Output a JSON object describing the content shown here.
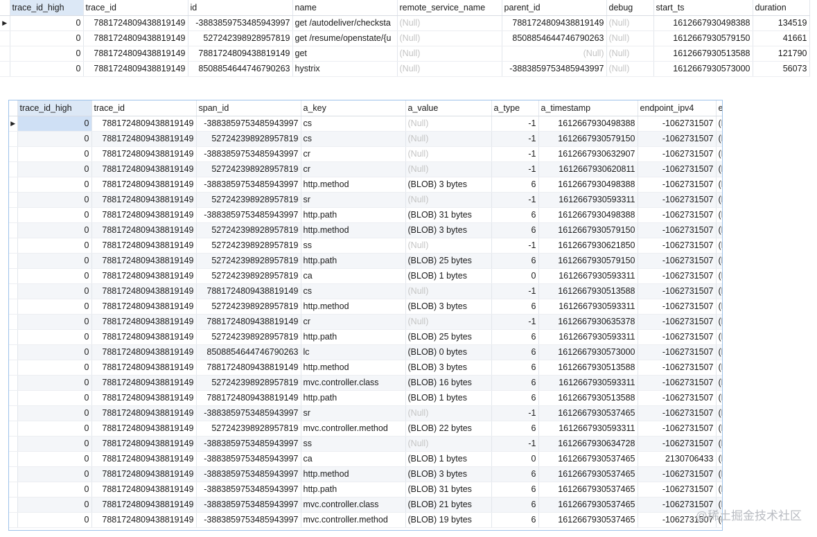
{
  "grid1": {
    "columns": [
      "trace_id_high",
      "trace_id",
      "id",
      "name",
      "remote_service_name",
      "parent_id",
      "debug",
      "start_ts",
      "duration"
    ],
    "rows": [
      [
        "0",
        "7881724809438819149",
        "-3883859753485943997",
        "get /autodeliver/checksta",
        "(Null)",
        "7881724809438819149",
        "(Null)",
        "1612667930498388",
        "134519"
      ],
      [
        "0",
        "7881724809438819149",
        "527242398928957819",
        "get /resume/openstate/{u",
        "(Null)",
        "8508854644746790263",
        "(Null)",
        "1612667930579150",
        "41661"
      ],
      [
        "0",
        "7881724809438819149",
        "7881724809438819149",
        "get",
        "(Null)",
        "(Null)",
        "(Null)",
        "1612667930513588",
        "121790"
      ],
      [
        "0",
        "7881724809438819149",
        "8508854644746790263",
        "hystrix",
        "(Null)",
        "-3883859753485943997",
        "(Null)",
        "1612667930573000",
        "56073"
      ]
    ]
  },
  "grid2": {
    "columns": [
      "trace_id_high",
      "trace_id",
      "span_id",
      "a_key",
      "a_value",
      "a_type",
      "a_timestamp",
      "endpoint_ipv4",
      "e"
    ],
    "rows": [
      [
        "0",
        "7881724809438819149",
        "-3883859753485943997",
        "cs",
        "(Null)",
        "-1",
        "1612667930498388",
        "-1062731507",
        "(N"
      ],
      [
        "0",
        "7881724809438819149",
        "527242398928957819",
        "cs",
        "(Null)",
        "-1",
        "1612667930579150",
        "-1062731507",
        "(N"
      ],
      [
        "0",
        "7881724809438819149",
        "-3883859753485943997",
        "cr",
        "(Null)",
        "-1",
        "1612667930632907",
        "-1062731507",
        "(N"
      ],
      [
        "0",
        "7881724809438819149",
        "527242398928957819",
        "cr",
        "(Null)",
        "-1",
        "1612667930620811",
        "-1062731507",
        "(N"
      ],
      [
        "0",
        "7881724809438819149",
        "-3883859753485943997",
        "http.method",
        "(BLOB) 3 bytes",
        "6",
        "1612667930498388",
        "-1062731507",
        "(N"
      ],
      [
        "0",
        "7881724809438819149",
        "527242398928957819",
        "sr",
        "(Null)",
        "-1",
        "1612667930593311",
        "-1062731507",
        "(N"
      ],
      [
        "0",
        "7881724809438819149",
        "-3883859753485943997",
        "http.path",
        "(BLOB) 31 bytes",
        "6",
        "1612667930498388",
        "-1062731507",
        "(N"
      ],
      [
        "0",
        "7881724809438819149",
        "527242398928957819",
        "http.method",
        "(BLOB) 3 bytes",
        "6",
        "1612667930579150",
        "-1062731507",
        "(N"
      ],
      [
        "0",
        "7881724809438819149",
        "527242398928957819",
        "ss",
        "(Null)",
        "-1",
        "1612667930621850",
        "-1062731507",
        "(N"
      ],
      [
        "0",
        "7881724809438819149",
        "527242398928957819",
        "http.path",
        "(BLOB) 25 bytes",
        "6",
        "1612667930579150",
        "-1062731507",
        "(N"
      ],
      [
        "0",
        "7881724809438819149",
        "527242398928957819",
        "ca",
        "(BLOB) 1 bytes",
        "0",
        "1612667930593311",
        "-1062731507",
        "(N"
      ],
      [
        "0",
        "7881724809438819149",
        "7881724809438819149",
        "cs",
        "(Null)",
        "-1",
        "1612667930513588",
        "-1062731507",
        "(N"
      ],
      [
        "0",
        "7881724809438819149",
        "527242398928957819",
        "http.method",
        "(BLOB) 3 bytes",
        "6",
        "1612667930593311",
        "-1062731507",
        "(N"
      ],
      [
        "0",
        "7881724809438819149",
        "7881724809438819149",
        "cr",
        "(Null)",
        "-1",
        "1612667930635378",
        "-1062731507",
        "(N"
      ],
      [
        "0",
        "7881724809438819149",
        "527242398928957819",
        "http.path",
        "(BLOB) 25 bytes",
        "6",
        "1612667930593311",
        "-1062731507",
        "(N"
      ],
      [
        "0",
        "7881724809438819149",
        "8508854644746790263",
        "lc",
        "(BLOB) 0 bytes",
        "6",
        "1612667930573000",
        "-1062731507",
        "(N"
      ],
      [
        "0",
        "7881724809438819149",
        "7881724809438819149",
        "http.method",
        "(BLOB) 3 bytes",
        "6",
        "1612667930513588",
        "-1062731507",
        "(N"
      ],
      [
        "0",
        "7881724809438819149",
        "527242398928957819",
        "mvc.controller.class",
        "(BLOB) 16 bytes",
        "6",
        "1612667930593311",
        "-1062731507",
        "(N"
      ],
      [
        "0",
        "7881724809438819149",
        "7881724809438819149",
        "http.path",
        "(BLOB) 1 bytes",
        "6",
        "1612667930513588",
        "-1062731507",
        "(N"
      ],
      [
        "0",
        "7881724809438819149",
        "-3883859753485943997",
        "sr",
        "(Null)",
        "-1",
        "1612667930537465",
        "-1062731507",
        "(N"
      ],
      [
        "0",
        "7881724809438819149",
        "527242398928957819",
        "mvc.controller.method",
        "(BLOB) 22 bytes",
        "6",
        "1612667930593311",
        "-1062731507",
        "(N"
      ],
      [
        "0",
        "7881724809438819149",
        "-3883859753485943997",
        "ss",
        "(Null)",
        "-1",
        "1612667930634728",
        "-1062731507",
        "(N"
      ],
      [
        "0",
        "7881724809438819149",
        "-3883859753485943997",
        "ca",
        "(BLOB) 1 bytes",
        "0",
        "1612667930537465",
        "2130706433",
        "(N"
      ],
      [
        "0",
        "7881724809438819149",
        "-3883859753485943997",
        "http.method",
        "(BLOB) 3 bytes",
        "6",
        "1612667930537465",
        "-1062731507",
        "(N"
      ],
      [
        "0",
        "7881724809438819149",
        "-3883859753485943997",
        "http.path",
        "(BLOB) 31 bytes",
        "6",
        "1612667930537465",
        "-1062731507",
        "(N"
      ],
      [
        "0",
        "7881724809438819149",
        "-3883859753485943997",
        "mvc.controller.class",
        "(BLOB) 21 bytes",
        "6",
        "1612667930537465",
        "-1062731507",
        "(N"
      ],
      [
        "0",
        "7881724809438819149",
        "-3883859753485943997",
        "mvc.controller.method",
        "(BLOB) 19 bytes",
        "6",
        "1612667930537465",
        "-1062731507",
        "(N"
      ]
    ]
  },
  "current_row_marker": "▶",
  "null_text": "(Null)",
  "watermark": "@稀土掘金技术社区",
  "colors": {
    "header_sorted": "#dce8f6",
    "selected_cell": "#cfe0f5",
    "null_text": "#c4c4c4",
    "grid_border": "#9ec3ea",
    "alt_row": "#f4f6f9"
  }
}
